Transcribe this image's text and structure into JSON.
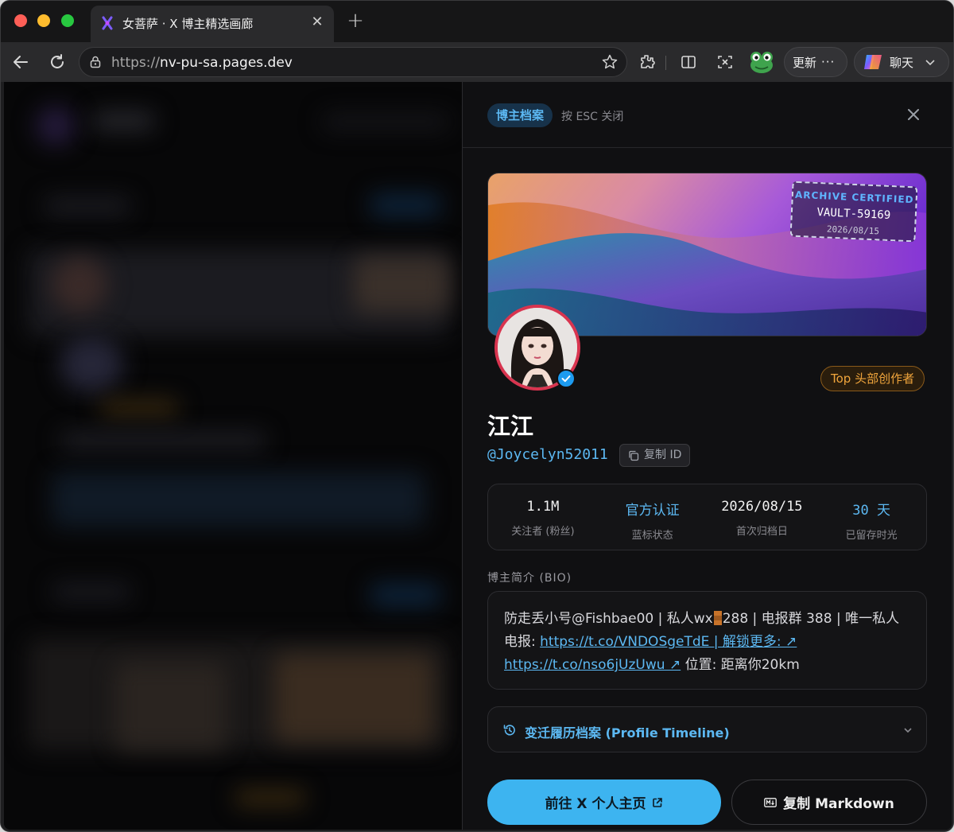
{
  "browser": {
    "tab_title": "女菩萨 · X 博主精选画廊",
    "url_scheme": "https://",
    "url_host": "nv-pu-sa.pages.dev",
    "update_label": "更新",
    "chat_label": "聊天"
  },
  "panel": {
    "archive_badge": "博主档案",
    "esc_hint": "按 ESC 关闭",
    "stamp": {
      "line1": "ARCHIVE CERTIFIED",
      "line2": "VAULT-59169",
      "line3": "2026/08/15"
    },
    "top_badge": "Top 头部创作者",
    "name": "江江",
    "handle": "@Joycelyn52011",
    "copy_id_label": "复制 ID",
    "stats": [
      {
        "value": "1.1M",
        "label": "关注者 (粉丝)"
      },
      {
        "value": "官方认证",
        "label": "蓝标状态"
      },
      {
        "value": "2026/08/15",
        "label": "首次归档日"
      },
      {
        "value": "30 天",
        "label": "已留存时光"
      }
    ],
    "bio_label": "博主简介 (BIO)",
    "bio": {
      "text1": "防走丢小号@Fishbae00 | 私人wx",
      "text2": "288 | 电报群 388 | 唯一私人电报: ",
      "link1": "https://t.co/VNDOSgeTdE | 解锁更多: ↗",
      "link2": "https://t.co/nso6jUzUwu ↗",
      "text3": " 位置: 距离你20km"
    },
    "timeline_label": "变迁履历档案 (Profile Timeline)",
    "primary_button": "前往 X 个人主页",
    "secondary_button": "复制 Markdown"
  },
  "colors": {
    "accent": "#3db4f0",
    "link": "#5cb8f2",
    "gold": "#f0a53c",
    "avatar_ring": "#d8344f"
  }
}
